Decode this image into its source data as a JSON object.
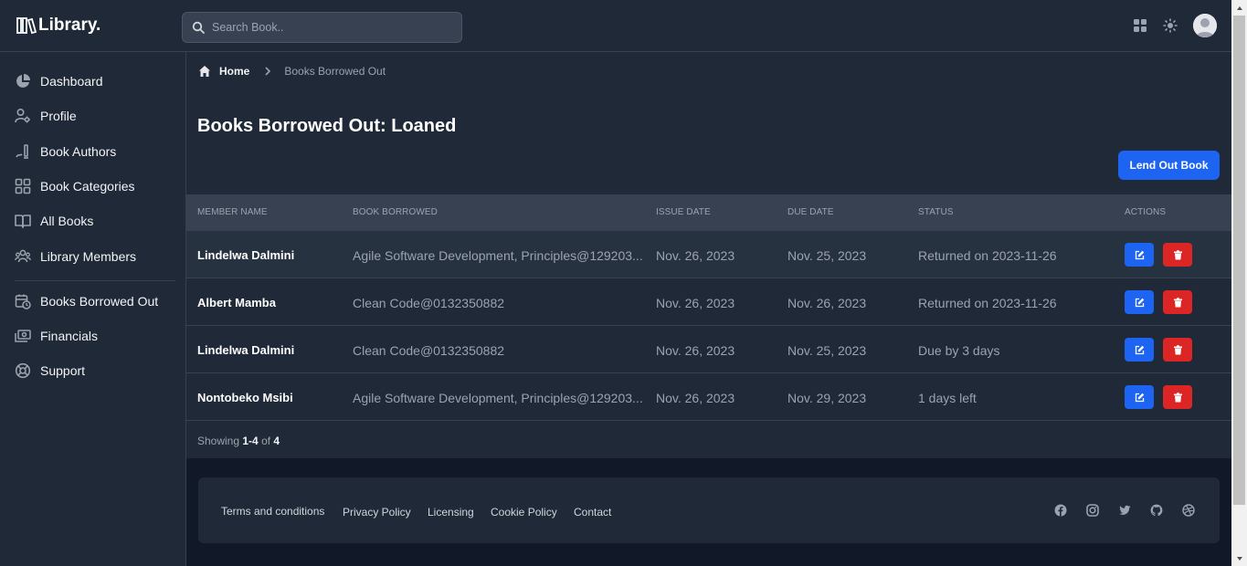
{
  "brand": {
    "name": "Library."
  },
  "search": {
    "placeholder": "Search Book.."
  },
  "sidebar": {
    "items": [
      {
        "label": "Dashboard",
        "icon": "pie-chart-icon"
      },
      {
        "label": "Profile",
        "icon": "user-cog-icon"
      },
      {
        "label": "Book Authors",
        "icon": "pen-icon"
      },
      {
        "label": "Book Categories",
        "icon": "grid-icon"
      },
      {
        "label": "All Books",
        "icon": "book-open-icon"
      },
      {
        "label": "Library Members",
        "icon": "users-icon"
      },
      {
        "label": "Books Borrowed Out",
        "icon": "calendar-clock-icon"
      },
      {
        "label": "Financials",
        "icon": "cash-icon"
      },
      {
        "label": "Support",
        "icon": "lifebuoy-icon"
      }
    ]
  },
  "breadcrumb": {
    "home": "Home",
    "current": "Books Borrowed Out"
  },
  "page": {
    "title": "Books Borrowed Out: Loaned",
    "lend_button": "Lend Out Book"
  },
  "table": {
    "headers": [
      "Member Name",
      "Book Borrowed",
      "Issue Date",
      "Due Date",
      "Status",
      "Actions"
    ],
    "rows": [
      {
        "member": "Lindelwa Dalmini",
        "book": "Agile Software Development, Principles@129203...",
        "issue": "Nov. 26, 2023",
        "due": "Nov. 25, 2023",
        "status": "Returned on 2023-11-26"
      },
      {
        "member": "Albert Mamba",
        "book": "Clean Code@0132350882",
        "issue": "Nov. 26, 2023",
        "due": "Nov. 26, 2023",
        "status": "Returned on 2023-11-26"
      },
      {
        "member": "Lindelwa Dalmini",
        "book": "Clean Code@0132350882",
        "issue": "Nov. 26, 2023",
        "due": "Nov. 25, 2023",
        "status": "Due by 3 days"
      },
      {
        "member": "Nontobeko Msibi",
        "book": "Agile Software Development, Principles@129203...",
        "issue": "Nov. 26, 2023",
        "due": "Nov. 29, 2023",
        "status": "1 days left"
      }
    ]
  },
  "pagination": {
    "showing_label": "Showing",
    "range": "1-4",
    "of_label": "of",
    "total": "4"
  },
  "footer": {
    "links": [
      "Terms and conditions",
      "Privacy Policy",
      "Licensing",
      "Cookie Policy",
      "Contact"
    ],
    "social": [
      "facebook-icon",
      "instagram-icon",
      "twitter-icon",
      "github-icon",
      "dribbble-icon"
    ]
  },
  "colors": {
    "background": "#111827",
    "panel": "#1f2937",
    "header_row": "#374151",
    "primary": "#1d64f2",
    "danger": "#dc2626"
  }
}
